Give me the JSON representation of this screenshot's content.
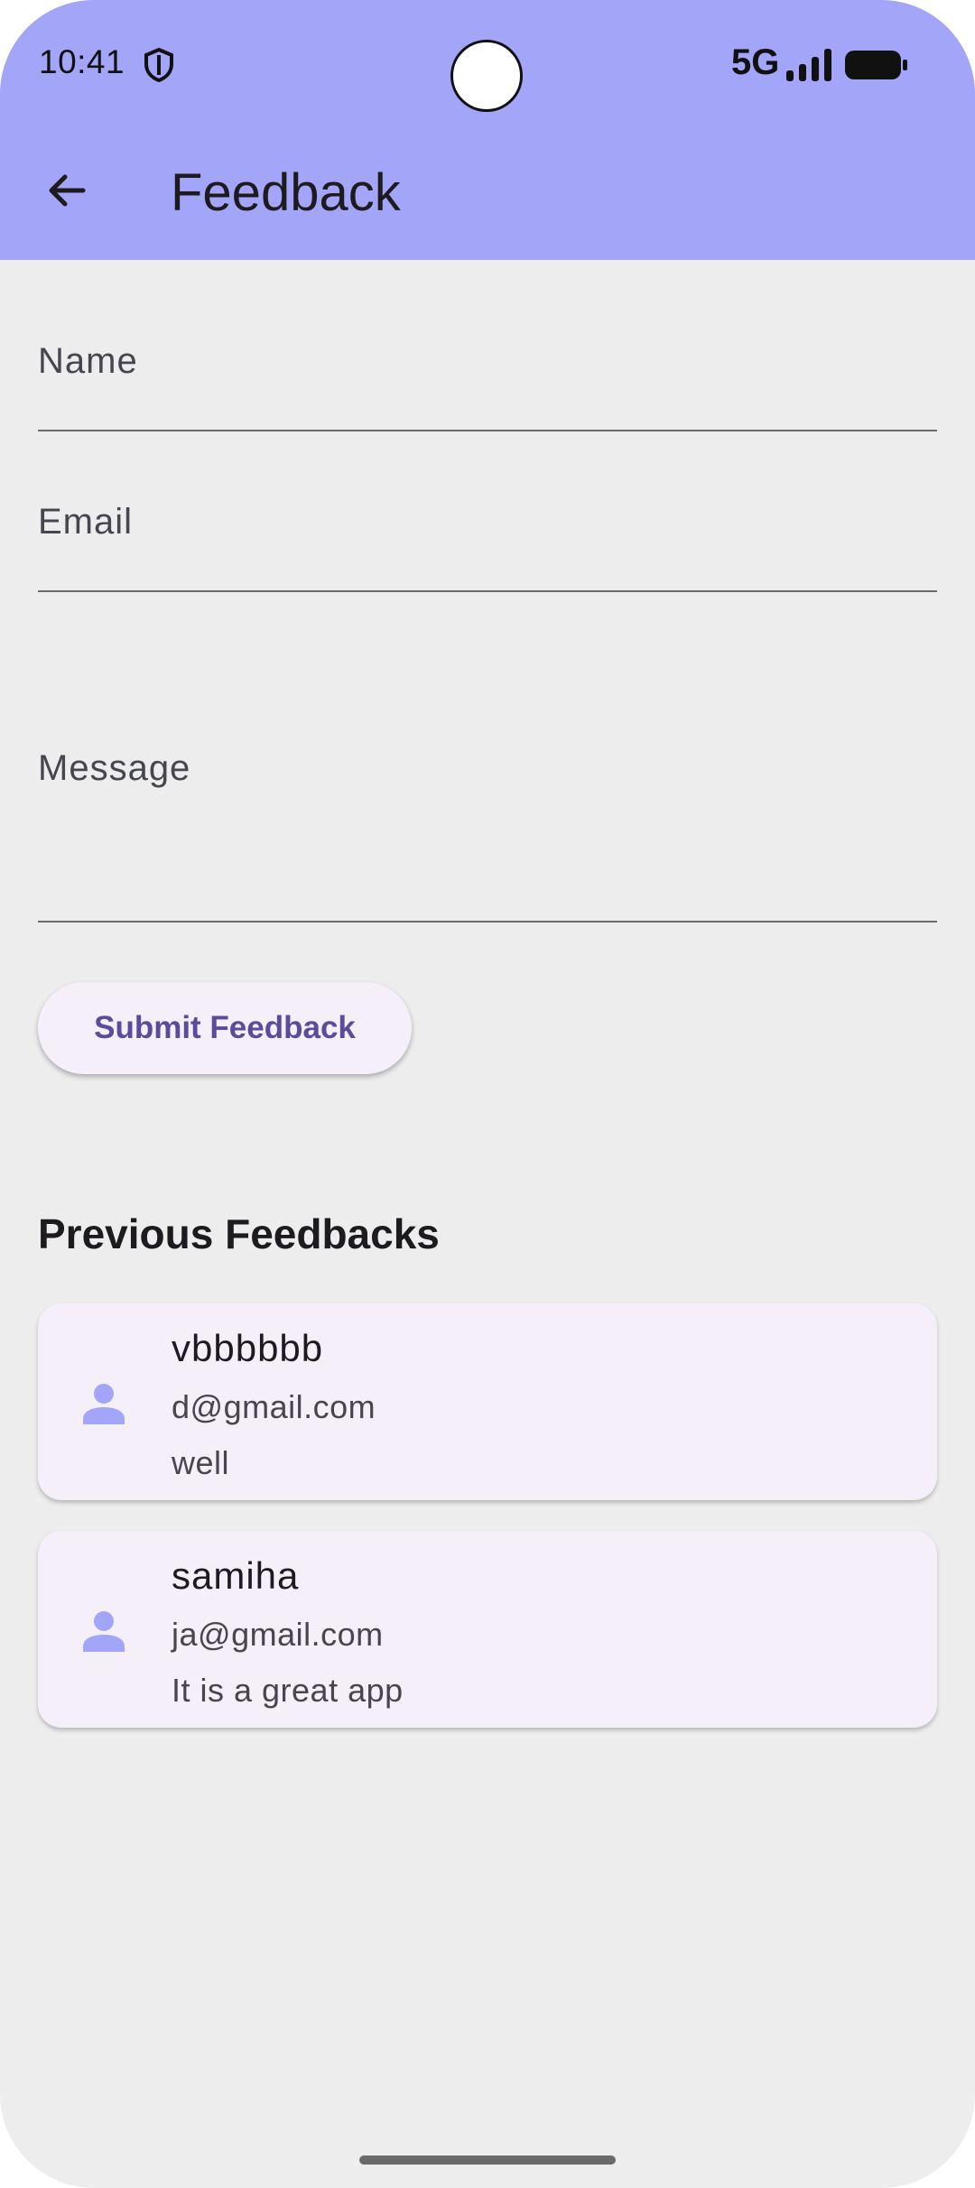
{
  "status_bar": {
    "time": "10:41",
    "network": "5G"
  },
  "appbar": {
    "title": "Feedback",
    "back_icon": "arrow-back-icon"
  },
  "form": {
    "name_label": "Name",
    "email_label": "Email",
    "message_label": "Message",
    "submit_label": "Submit Feedback"
  },
  "previous": {
    "heading": "Previous Feedbacks",
    "items": [
      {
        "name": "vbbbbbb",
        "email": "d@gmail.com",
        "message": "well",
        "icon": "person-icon"
      },
      {
        "name": "samiha",
        "email": "ja@gmail.com",
        "message": "It is a great app",
        "icon": "person-icon"
      }
    ]
  },
  "colors": {
    "appbar": "#a3a6f8",
    "background": "#ededed",
    "card": "#f4eff8",
    "accent": "#5b4b9c",
    "icon": "#a3a6f8"
  }
}
